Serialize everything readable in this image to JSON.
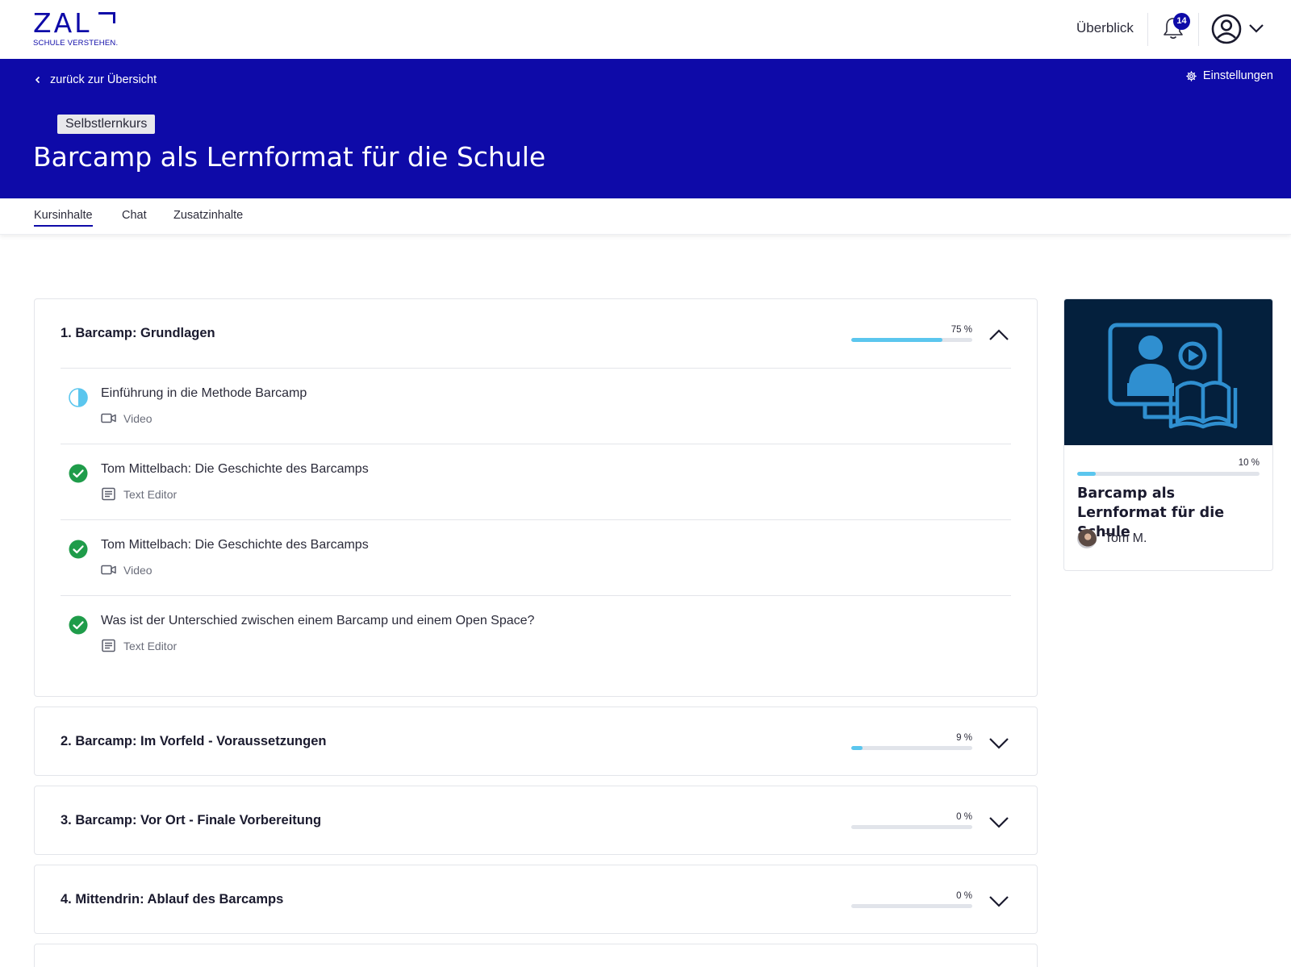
{
  "brand": {
    "logo_text": "ZAL",
    "tagline": "SCHULE VERSTEHEN."
  },
  "header": {
    "overview_label": "Überblick",
    "notification_count": "14"
  },
  "hero": {
    "back_label": "zurück zur Übersicht",
    "settings_label": "Einstellungen",
    "tag": "Selbstlernkurs",
    "title": "Barcamp als Lernformat für die Schule"
  },
  "tabs": [
    {
      "label": "Kursinhalte",
      "active": true
    },
    {
      "label": "Chat",
      "active": false
    },
    {
      "label": "Zusatzinhalte",
      "active": false
    }
  ],
  "sections": [
    {
      "title": "1.  Barcamp: Grundlagen",
      "progress_label": "75 %",
      "progress": 0.75,
      "expanded": true,
      "items": [
        {
          "title": "Einführung in die Methode Barcamp",
          "type": "Video",
          "type_icon": "video-icon",
          "status": "in-progress"
        },
        {
          "title": "Tom Mittelbach: Die Geschichte des Barcamps",
          "type": "Text Editor",
          "type_icon": "text-editor-icon",
          "status": "completed"
        },
        {
          "title": "Tom Mittelbach: Die Geschichte des Barcamps",
          "type": "Video",
          "type_icon": "video-icon",
          "status": "completed"
        },
        {
          "title": "Was ist der Unterschied zwischen einem Barcamp und einem Open Space?",
          "type": "Text Editor",
          "type_icon": "text-editor-icon",
          "status": "completed"
        }
      ]
    },
    {
      "title": "2.  Barcamp: Im Vorfeld - Voraussetzungen",
      "progress_label": "9 %",
      "progress": 0.09,
      "expanded": false
    },
    {
      "title": "3.  Barcamp: Vor Ort - Finale Vorbereitung",
      "progress_label": "0 %",
      "progress": 0.0,
      "expanded": false
    },
    {
      "title": "4.  Mittendrin: Ablauf des Barcamps",
      "progress_label": "0 %",
      "progress": 0.0,
      "expanded": false
    }
  ],
  "course_card": {
    "progress_label": "10 %",
    "progress": 0.1,
    "title": "Barcamp als Lernformat für die Schule",
    "author": "Tom M."
  },
  "colors": {
    "brand_blue": "#0e0aa8",
    "progress": "#5bc6ee",
    "complete": "#1f9c4a",
    "card_image_bg": "#04203d",
    "card_illustration": "#2f8fd0"
  }
}
